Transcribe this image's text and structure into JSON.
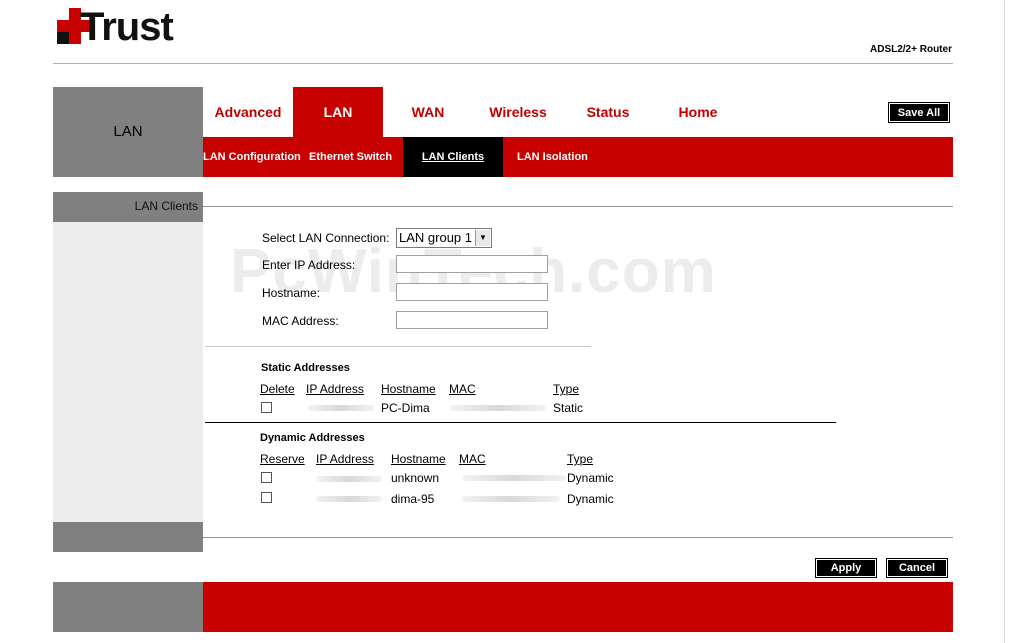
{
  "brand": {
    "logo_text": "Trust",
    "product": "ADSL2/2+ Router"
  },
  "sidebar": {
    "title": "LAN"
  },
  "tabs": [
    {
      "label": "Advanced",
      "active": false
    },
    {
      "label": "LAN",
      "active": true
    },
    {
      "label": "WAN",
      "active": false
    },
    {
      "label": "Wireless",
      "active": false
    },
    {
      "label": "Status",
      "active": false
    },
    {
      "label": "Home",
      "active": false
    }
  ],
  "save_all_label": "Save All",
  "subtabs": [
    {
      "label": "LAN Configuration",
      "active": false
    },
    {
      "label": "Ethernet Switch",
      "active": false
    },
    {
      "label": "LAN Clients",
      "active": true
    },
    {
      "label": "LAN Isolation",
      "active": false
    }
  ],
  "section": {
    "title": "LAN Clients"
  },
  "form": {
    "select_lan_label": "Select LAN Connection:",
    "select_lan_value": "LAN group 1",
    "ip_label": "Enter IP Address:",
    "ip_value": "",
    "hostname_label": "Hostname:",
    "hostname_value": "",
    "mac_label": "MAC Address:",
    "mac_value": ""
  },
  "static": {
    "title": "Static Addresses",
    "headers": [
      "Delete",
      "IP Address",
      "Hostname",
      "MAC",
      "Type"
    ],
    "rows": [
      {
        "ip": "",
        "hostname": "PC-Dima",
        "mac": "",
        "type": "Static"
      }
    ]
  },
  "dynamic": {
    "title": "Dynamic Addresses",
    "headers": [
      "Reserve",
      "IP Address",
      "Hostname",
      "MAC",
      "Type"
    ],
    "rows": [
      {
        "ip": "",
        "hostname": "unknown",
        "mac": "",
        "type": "Dynamic"
      },
      {
        "ip": "",
        "hostname": "dima-95",
        "mac": "",
        "type": "Dynamic"
      }
    ]
  },
  "actions": {
    "apply": "Apply",
    "cancel": "Cancel"
  },
  "watermark": "PcWinTech.com",
  "colors": {
    "accent": "#c80000",
    "sidebar": "#808080",
    "dark": "#000000"
  }
}
